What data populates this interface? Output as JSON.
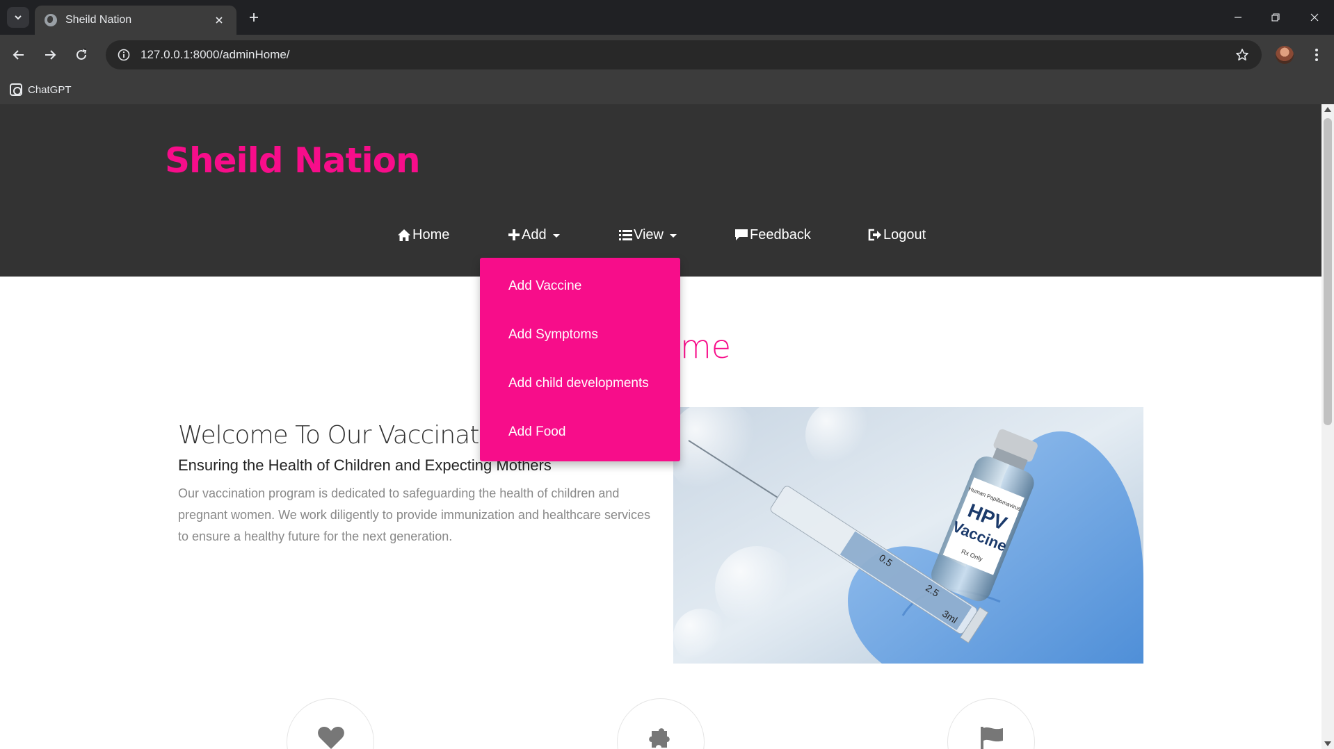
{
  "browser": {
    "tab_title": "Sheild Nation",
    "url": "127.0.0.1:8000/adminHome/",
    "bookmark_label": "ChatGPT"
  },
  "site": {
    "brand": "Sheild Nation",
    "brand_color": "#f70d8a",
    "header_bg": "#333333",
    "nav": {
      "home": "Home",
      "add": "Add",
      "view": "View",
      "feedback": "Feedback",
      "logout": "Logout"
    },
    "add_menu": [
      "Add Vaccine",
      "Add Symptoms",
      "Add child developments",
      "Add Food"
    ]
  },
  "main": {
    "section_title_visible": "me",
    "about": {
      "heading": "Welcome To Our Vaccination",
      "subheading": "Ensuring the Health of Children and Expecting Mothers",
      "body": "Our vaccination program is dedicated to safeguarding the health of children and pregnant women. We work diligently to provide immunization and healthcare services to ensure a healthy future for the next generation."
    },
    "hero_image": {
      "label_line1": "HPV",
      "label_line2": "Vaccine",
      "label_small": "Human Papillomavirus",
      "rx": "Rx Only",
      "syringe_mark_1": "0.5",
      "syringe_mark_2": "2.5",
      "syringe_mark_3": "3ml"
    },
    "feature_icons": [
      "heart-icon",
      "puzzle-icon",
      "flag-icon"
    ]
  }
}
